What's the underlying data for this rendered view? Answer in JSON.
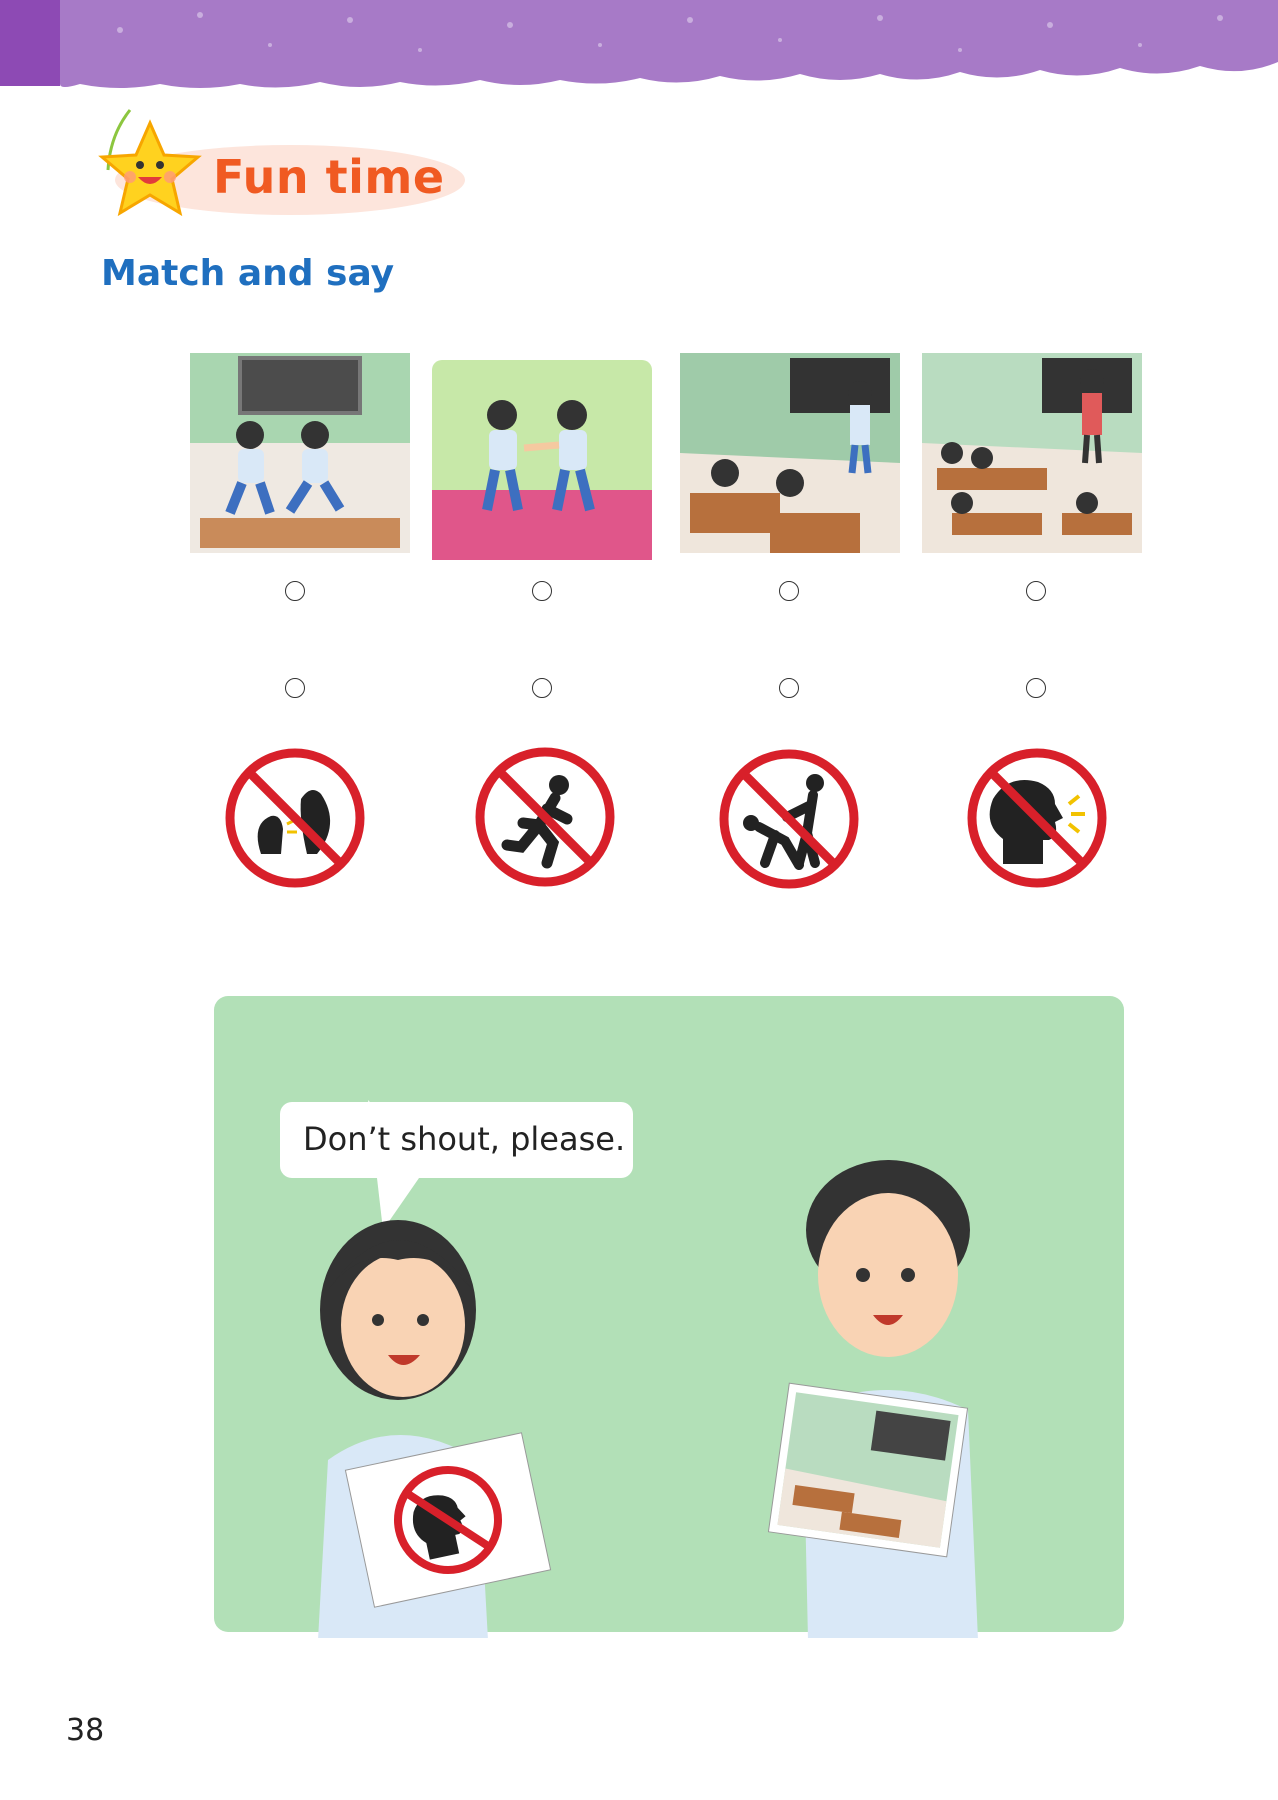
{
  "header": {
    "title": "Fun time",
    "subtitle": "Match and say"
  },
  "activity": {
    "scenes": [
      {
        "icon": "running-kids-scene"
      },
      {
        "icon": "pushing-kids-scene"
      },
      {
        "icon": "shouting-in-class-scene"
      },
      {
        "icon": "talking-in-class-scene"
      }
    ],
    "signs": [
      {
        "icon": "no-talking-sign-icon"
      },
      {
        "icon": "no-running-sign-icon"
      },
      {
        "icon": "no-pushing-sign-icon"
      },
      {
        "icon": "no-shouting-sign-icon"
      }
    ]
  },
  "example": {
    "speech": "Don’t shout, please."
  },
  "footer": {
    "page_number": "38"
  },
  "colors": {
    "banner": "#a77ac7",
    "title": "#f05a22",
    "subtitle": "#1f6fbf",
    "panel": "#b2e0b7",
    "sign_red": "#d8202a"
  }
}
